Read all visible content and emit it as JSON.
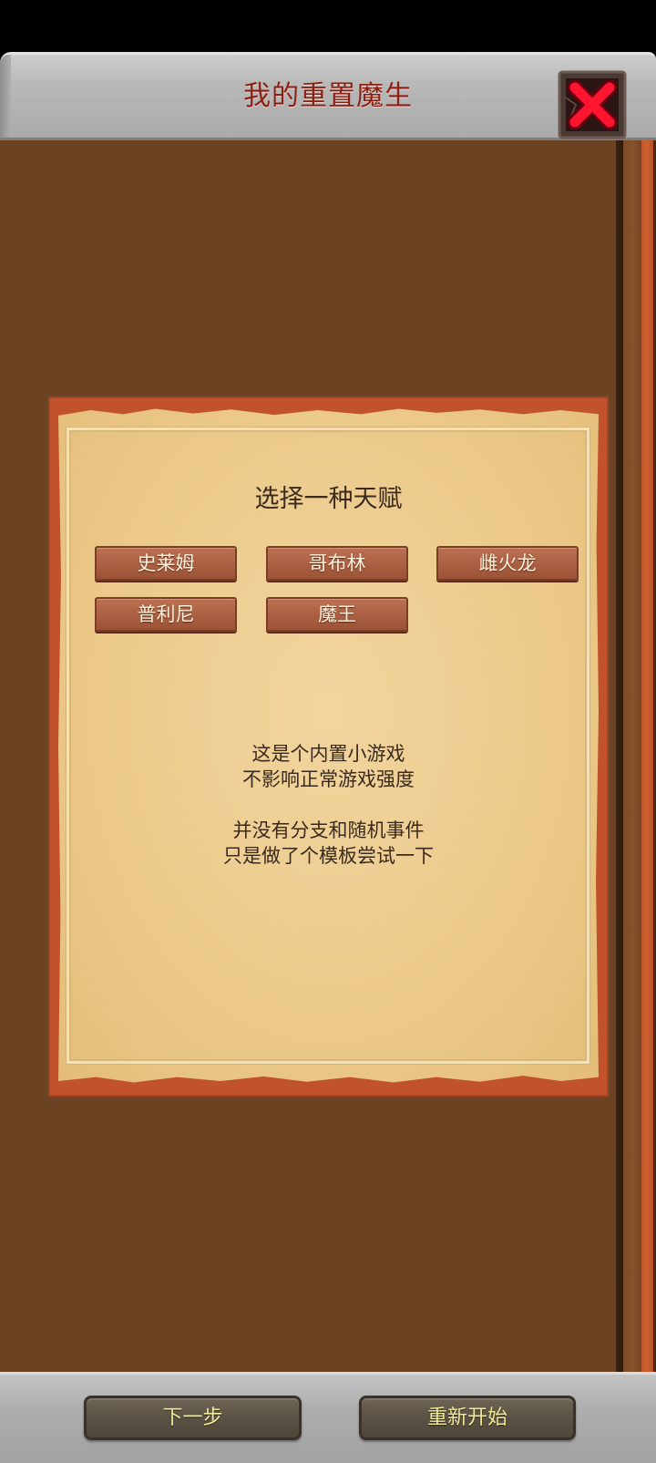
{
  "header": {
    "title": "我的重置魔生",
    "close_icon": "close-x-icon"
  },
  "talent_panel": {
    "heading": "选择一种天赋",
    "options": [
      {
        "label": "史莱姆"
      },
      {
        "label": "哥布林"
      },
      {
        "label": "雌火龙"
      },
      {
        "label": "普利尼"
      },
      {
        "label": "魔王"
      }
    ],
    "notes": [
      [
        "这是个内置小游戏",
        "不影响正常游戏强度"
      ],
      [
        "并没有分支和随机事件",
        "只是做了个模板尝试一下"
      ]
    ]
  },
  "footer": {
    "next_label": "下一步",
    "restart_label": "重新开始"
  },
  "colors": {
    "title_text": "#8a1f12",
    "panel_brown": "#6b4322",
    "parchment": "#ecc98a",
    "parchment_border": "#c1522b",
    "option_button": "#ad6245",
    "footer_button_text": "#f2ea98",
    "close_x": "#ff1530"
  }
}
